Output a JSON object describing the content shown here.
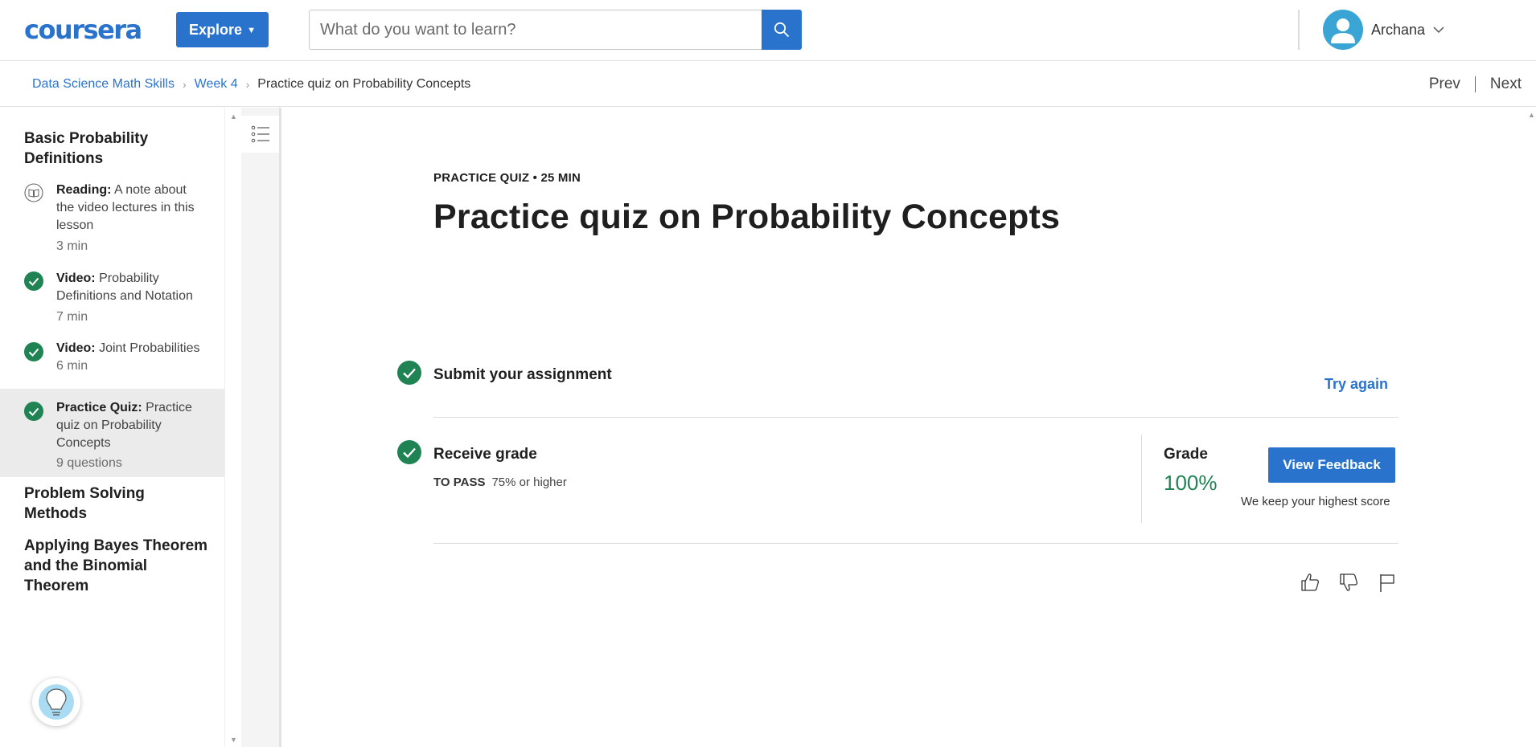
{
  "header": {
    "logo": "coursera",
    "explore_label": "Explore",
    "search_placeholder": "What do you want to learn?",
    "user_name": "Archana"
  },
  "breadcrumb": {
    "items": [
      "Data Science Math Skills",
      "Week 4"
    ],
    "current": "Practice quiz on Probability Concepts",
    "prev_label": "Prev",
    "next_label": "Next"
  },
  "sidebar": {
    "sections": [
      "Basic Probability Definitions",
      "Problem Solving Methods",
      "Applying Bayes Theorem and the Binomial Theorem"
    ],
    "lessons": [
      {
        "type": "Reading:",
        "title": "A note about the video lectures in this lesson",
        "duration": "3 min",
        "icon": "book-icon",
        "completed": false
      },
      {
        "type": "Video:",
        "title": "Probability Definitions and Notation",
        "duration": "7 min",
        "icon": "check-circle-icon",
        "completed": true
      },
      {
        "type": "Video:",
        "title": "Joint Probabilities",
        "duration": "6 min",
        "icon": "check-circle-icon",
        "completed": true
      },
      {
        "type": "Practice Quiz:",
        "title": "Practice quiz on Probability Concepts",
        "duration": "9 questions",
        "icon": "check-circle-icon",
        "completed": true,
        "active": true
      }
    ]
  },
  "main": {
    "meta": "PRACTICE QUIZ • 25 MIN",
    "title": "Practice quiz on Probability Concepts",
    "submit": {
      "label": "Submit your assignment",
      "action": "Try again"
    },
    "receive": {
      "label": "Receive grade",
      "to_pass_label": "TO PASS",
      "to_pass_value": "75% or higher",
      "grade_label": "Grade",
      "grade_value": "100%",
      "feedback_button": "View Feedback",
      "note": "We keep your highest score"
    }
  },
  "colors": {
    "brand_blue": "#2a73cc",
    "success_green": "#1f8354",
    "active_row": "#ebebeb"
  }
}
